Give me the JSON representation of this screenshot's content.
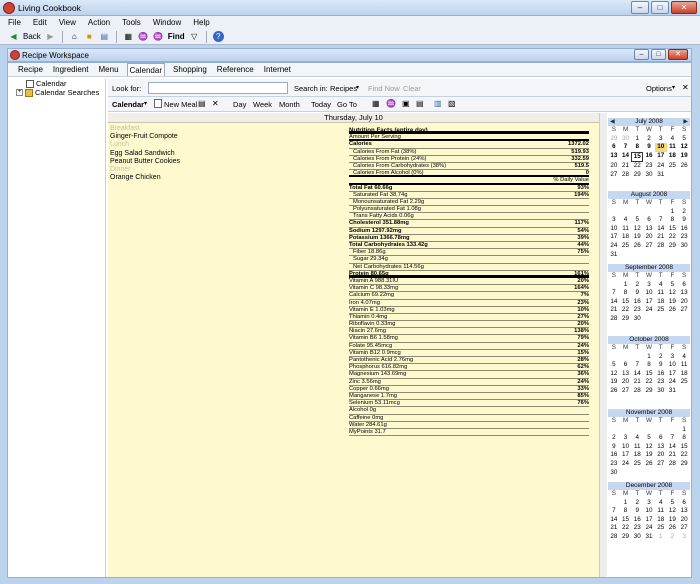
{
  "app": {
    "title": "Living Cookbook"
  },
  "menu": [
    "File",
    "Edit",
    "View",
    "Action",
    "Tools",
    "Window",
    "Help"
  ],
  "toolbar": {
    "back": "Back",
    "find": "Find"
  },
  "workspace": {
    "title": "Recipe Workspace",
    "tabs": [
      "Recipe",
      "Ingredient",
      "Menu",
      "Calendar",
      "Shopping",
      "Reference",
      "Internet"
    ],
    "tree": [
      "Calendar",
      "Calendar Searches"
    ]
  },
  "lookbar": {
    "look_for": "Look for:",
    "search_in": "Search in:",
    "search_in_value": "Recipes",
    "find_now": "Find Now",
    "clear": "Clear",
    "options": "Options"
  },
  "calbar": {
    "calendar": "Calendar",
    "new_meal": "New Meal",
    "day": "Day",
    "week": "Week",
    "month": "Month",
    "today": "Today",
    "goto": "Go To"
  },
  "day": {
    "header": "Thursday, July 10",
    "meals": [
      {
        "label": "Breakfast",
        "items": [
          "Ginger-Fruit Compote"
        ]
      },
      {
        "label": "Lunch",
        "items": [
          "Egg Salad Sandwich",
          "Peanut Butter Cookies"
        ]
      },
      {
        "label": "Dinner",
        "items": [
          "Orange Chicken"
        ]
      }
    ]
  },
  "nutrition": {
    "title": "Nutrition Facts (entire day)",
    "rows": [
      {
        "name": "Amount Per Serving",
        "value": "",
        "style": ""
      },
      {
        "name": "Calories",
        "value": "1372.02",
        "style": "b"
      },
      {
        "name": "Calories From Fat (38%)",
        "value": "519.93",
        "style": "i"
      },
      {
        "name": "Calories From Protein (24%)",
        "value": "332.59",
        "style": "i"
      },
      {
        "name": "Calories From Carbohydrates (38%)",
        "value": "519.5",
        "style": "i"
      },
      {
        "name": "Calories From Alcohol (0%)",
        "value": "0",
        "style": "i"
      },
      {
        "name": "",
        "value": "% Daily Value",
        "style": ""
      },
      {
        "name": "Total Fat 60.66g",
        "value": "93%",
        "style": "b"
      },
      {
        "name": "Saturated Fat 38.74g",
        "value": "194%",
        "style": "i"
      },
      {
        "name": "Monounsaturated Fat 2.29g",
        "value": "",
        "style": "i"
      },
      {
        "name": "Polyunsaturated Fat 1.08g",
        "value": "",
        "style": "i"
      },
      {
        "name": "Trans Fatty Acids 0.06g",
        "value": "",
        "style": "i"
      },
      {
        "name": "Cholesterol 351.88mg",
        "value": "117%",
        "style": "b"
      },
      {
        "name": "Sodium 1297.92mg",
        "value": "54%",
        "style": "b"
      },
      {
        "name": "Potassium 1366.78mg",
        "value": "39%",
        "style": "b"
      },
      {
        "name": "Total Carbohydrates 133.42g",
        "value": "44%",
        "style": "b"
      },
      {
        "name": "Fiber 18.86g",
        "value": "75%",
        "style": "i"
      },
      {
        "name": "Sugar 29.34g",
        "value": "",
        "style": "i"
      },
      {
        "name": "Net Carbohydrates 114.56g",
        "value": "",
        "style": "i"
      },
      {
        "name": "Protein 80.65g",
        "value": "161%",
        "style": "b"
      },
      {
        "name": "Vitamin A 988.31IU",
        "value": "20%",
        "style": ""
      },
      {
        "name": "Vitamin C 98.33mg",
        "value": "164%",
        "style": ""
      },
      {
        "name": "Calcium 69.22mg",
        "value": "7%",
        "style": ""
      },
      {
        "name": "Iron 4.07mg",
        "value": "23%",
        "style": ""
      },
      {
        "name": "Vitamin E 1.03mg",
        "value": "10%",
        "style": ""
      },
      {
        "name": "Thiamin 0.4mg",
        "value": "27%",
        "style": ""
      },
      {
        "name": "Riboflavin 0.33mg",
        "value": "20%",
        "style": ""
      },
      {
        "name": "Niacin 27.6mg",
        "value": "138%",
        "style": ""
      },
      {
        "name": "Vitamin B6 1.58mg",
        "value": "79%",
        "style": ""
      },
      {
        "name": "Folate 95.45mcg",
        "value": "24%",
        "style": ""
      },
      {
        "name": "Vitamin B12 0.9mcg",
        "value": "15%",
        "style": ""
      },
      {
        "name": "Pantothenic Acid 2.76mg",
        "value": "28%",
        "style": ""
      },
      {
        "name": "Phosphorus 616.82mg",
        "value": "62%",
        "style": ""
      },
      {
        "name": "Magnesium 143.69mg",
        "value": "36%",
        "style": ""
      },
      {
        "name": "Zinc 3.56mg",
        "value": "24%",
        "style": ""
      },
      {
        "name": "Copper 0.66mg",
        "value": "33%",
        "style": ""
      },
      {
        "name": "Manganese 1.7mg",
        "value": "85%",
        "style": ""
      },
      {
        "name": "Selenium 53.11mcg",
        "value": "76%",
        "style": ""
      },
      {
        "name": "Alcohol 0g",
        "value": "",
        "style": ""
      },
      {
        "name": "Caffeine 0mg",
        "value": "",
        "style": ""
      },
      {
        "name": "Water 284.61g",
        "value": "",
        "style": ""
      },
      {
        "name": "MyPoints 31.7",
        "value": "",
        "style": ""
      }
    ]
  },
  "calendars": [
    {
      "month": "July 2008",
      "weeks": [
        [
          "29",
          "30",
          "1",
          "2",
          "3",
          "4",
          "5"
        ],
        [
          "6",
          "7",
          "8",
          "9",
          "10",
          "11",
          "12"
        ],
        [
          "13",
          "14",
          "15",
          "16",
          "17",
          "18",
          "19"
        ],
        [
          "20",
          "21",
          "22",
          "23",
          "24",
          "25",
          "26"
        ],
        [
          "27",
          "28",
          "29",
          "30",
          "31",
          "",
          ""
        ]
      ]
    },
    {
      "month": "August 2008",
      "weeks": [
        [
          "",
          "",
          "",
          "",
          "",
          "1",
          "2"
        ],
        [
          "3",
          "4",
          "5",
          "6",
          "7",
          "8",
          "9"
        ],
        [
          "10",
          "11",
          "12",
          "13",
          "14",
          "15",
          "16"
        ],
        [
          "17",
          "18",
          "19",
          "20",
          "21",
          "22",
          "23"
        ],
        [
          "24",
          "25",
          "26",
          "27",
          "28",
          "29",
          "30"
        ],
        [
          "31",
          "",
          "",
          "",
          "",
          "",
          ""
        ]
      ]
    },
    {
      "month": "September 2008",
      "weeks": [
        [
          "",
          "1",
          "2",
          "3",
          "4",
          "5",
          "6"
        ],
        [
          "7",
          "8",
          "9",
          "10",
          "11",
          "12",
          "13"
        ],
        [
          "14",
          "15",
          "16",
          "17",
          "18",
          "19",
          "20"
        ],
        [
          "21",
          "22",
          "23",
          "24",
          "25",
          "26",
          "27"
        ],
        [
          "28",
          "29",
          "30",
          "",
          "",
          "",
          ""
        ]
      ]
    },
    {
      "month": "October 2008",
      "weeks": [
        [
          "",
          "",
          "",
          "1",
          "2",
          "3",
          "4"
        ],
        [
          "5",
          "6",
          "7",
          "8",
          "9",
          "10",
          "11"
        ],
        [
          "12",
          "13",
          "14",
          "15",
          "16",
          "17",
          "18"
        ],
        [
          "19",
          "20",
          "21",
          "22",
          "23",
          "24",
          "25"
        ],
        [
          "26",
          "27",
          "28",
          "29",
          "30",
          "31",
          ""
        ]
      ]
    },
    {
      "month": "November 2008",
      "weeks": [
        [
          "",
          "",
          "",
          "",
          "",
          "",
          "1"
        ],
        [
          "2",
          "3",
          "4",
          "5",
          "6",
          "7",
          "8"
        ],
        [
          "9",
          "10",
          "11",
          "12",
          "13",
          "14",
          "15"
        ],
        [
          "16",
          "17",
          "18",
          "19",
          "20",
          "21",
          "22"
        ],
        [
          "23",
          "24",
          "25",
          "26",
          "27",
          "28",
          "29"
        ],
        [
          "30",
          "",
          "",
          "",
          "",
          "",
          ""
        ]
      ]
    },
    {
      "month": "December 2008",
      "weeks": [
        [
          "",
          "1",
          "2",
          "3",
          "4",
          "5",
          "6"
        ],
        [
          "7",
          "8",
          "9",
          "10",
          "11",
          "12",
          "13"
        ],
        [
          "14",
          "15",
          "16",
          "17",
          "18",
          "19",
          "20"
        ],
        [
          "21",
          "22",
          "23",
          "24",
          "25",
          "26",
          "27"
        ],
        [
          "28",
          "29",
          "30",
          "31",
          "1",
          "2",
          "3"
        ]
      ]
    }
  ],
  "weekday_letters": [
    "S",
    "M",
    "T",
    "W",
    "T",
    "F",
    "S"
  ]
}
